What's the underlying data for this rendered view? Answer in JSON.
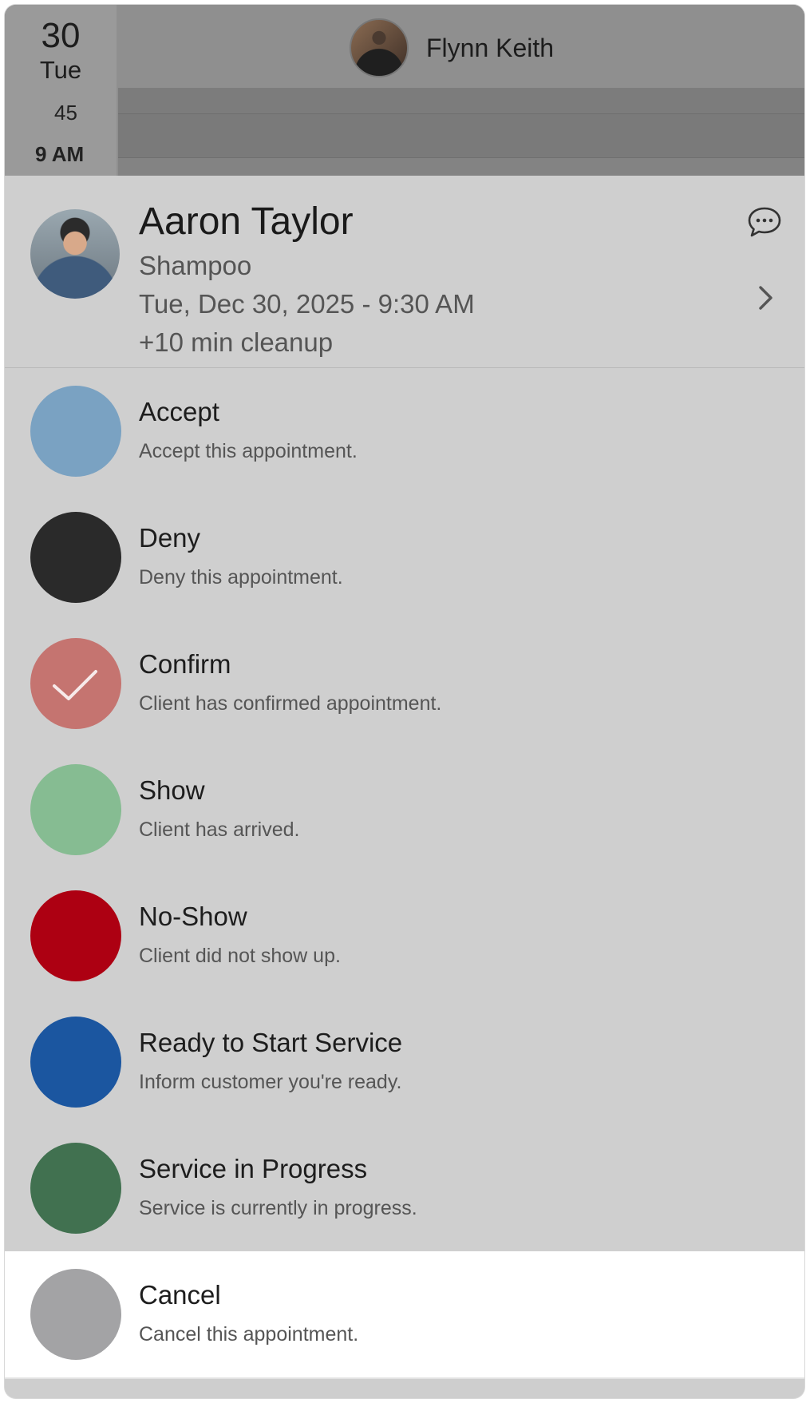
{
  "calendar": {
    "day_number": "30",
    "day_name": "Tue",
    "slot_45": "45",
    "slot_9am": "9 AM",
    "staff_name": "Flynn Keith"
  },
  "appointment": {
    "client_name": "Aaron Taylor",
    "service": "Shampoo",
    "datetime": "Tue, Dec 30, 2025 - 9:30 AM",
    "cleanup": "+10 min cleanup"
  },
  "options": [
    {
      "title": "Accept",
      "desc": "Accept this appointment.",
      "color": "#7aa2c2"
    },
    {
      "title": "Deny",
      "desc": "Deny this appointment.",
      "color": "#2a2a2a"
    },
    {
      "title": "Confirm",
      "desc": "Client has confirmed appointment.",
      "color": "#c57470",
      "icon": "checkmark-icon"
    },
    {
      "title": "Show",
      "desc": "Client has arrived.",
      "color": "#86bc92"
    },
    {
      "title": "No-Show",
      "desc": "Client did not show up.",
      "color": "#ad0012"
    },
    {
      "title": "Ready to Start Service",
      "desc": "Inform customer you're ready.",
      "color": "#1b56a0"
    },
    {
      "title": "Service in Progress",
      "desc": "Service is currently in progress.",
      "color": "#417150"
    },
    {
      "title": "Cancel",
      "desc": "Cancel this appointment.",
      "color": "#a3a3a5"
    }
  ]
}
